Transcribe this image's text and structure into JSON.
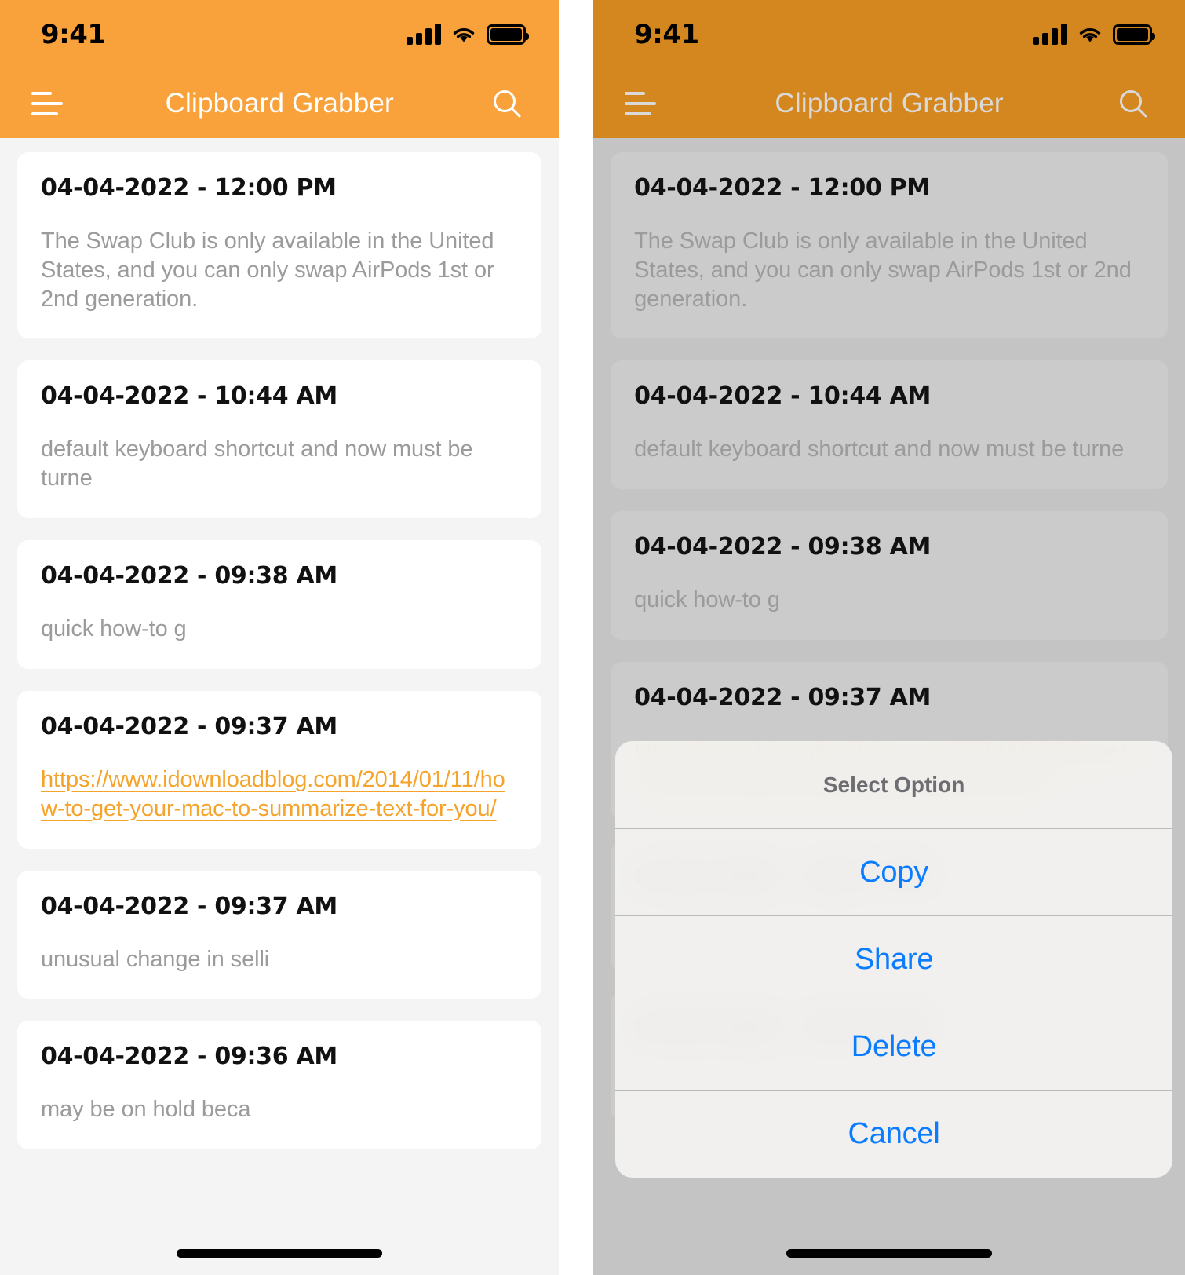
{
  "status_bar": {
    "time": "9:41",
    "icons": [
      "signal-icon",
      "wifi-icon",
      "battery-icon"
    ]
  },
  "nav": {
    "title": "Clipboard Grabber",
    "menu_icon": "hamburger-menu-icon",
    "search_icon": "search-icon",
    "bg_color_left": "#f9a23c",
    "bg_color_right": "#d4871f"
  },
  "clips": [
    {
      "date": "04-04-2022 - 12:00 PM",
      "text": "The Swap Club is only available in the United States, and you can only swap AirPods 1st or 2nd generation.",
      "is_link": false
    },
    {
      "date": "04-04-2022 - 10:44 AM",
      "text": "default keyboard shortcut and now must be turne",
      "is_link": false
    },
    {
      "date": "04-04-2022 - 09:38 AM",
      "text": "quick how-to g",
      "is_link": false
    },
    {
      "date": "04-04-2022 - 09:37 AM",
      "text": "https://www.idownloadblog.com/2014/01/11/how-to-get-your-mac-to-summarize-text-for-you/",
      "is_link": true
    },
    {
      "date": "04-04-2022 - 09:37 AM",
      "text": "unusual change in selli",
      "is_link": false
    },
    {
      "date": "04-04-2022 - 09:36 AM",
      "text": "may be on hold beca",
      "is_link": false
    }
  ],
  "action_sheet": {
    "title": "Select Option",
    "options": [
      {
        "label": "Copy"
      },
      {
        "label": "Share"
      },
      {
        "label": "Delete"
      },
      {
        "label": "Cancel"
      }
    ],
    "accent_color": "#0a7cff"
  },
  "colors": {
    "link": "#f5a32a",
    "card_bg": "#ffffff",
    "list_bg": "#f4f4f4",
    "body_text": "#9b9b9b",
    "date_text": "#111111"
  }
}
